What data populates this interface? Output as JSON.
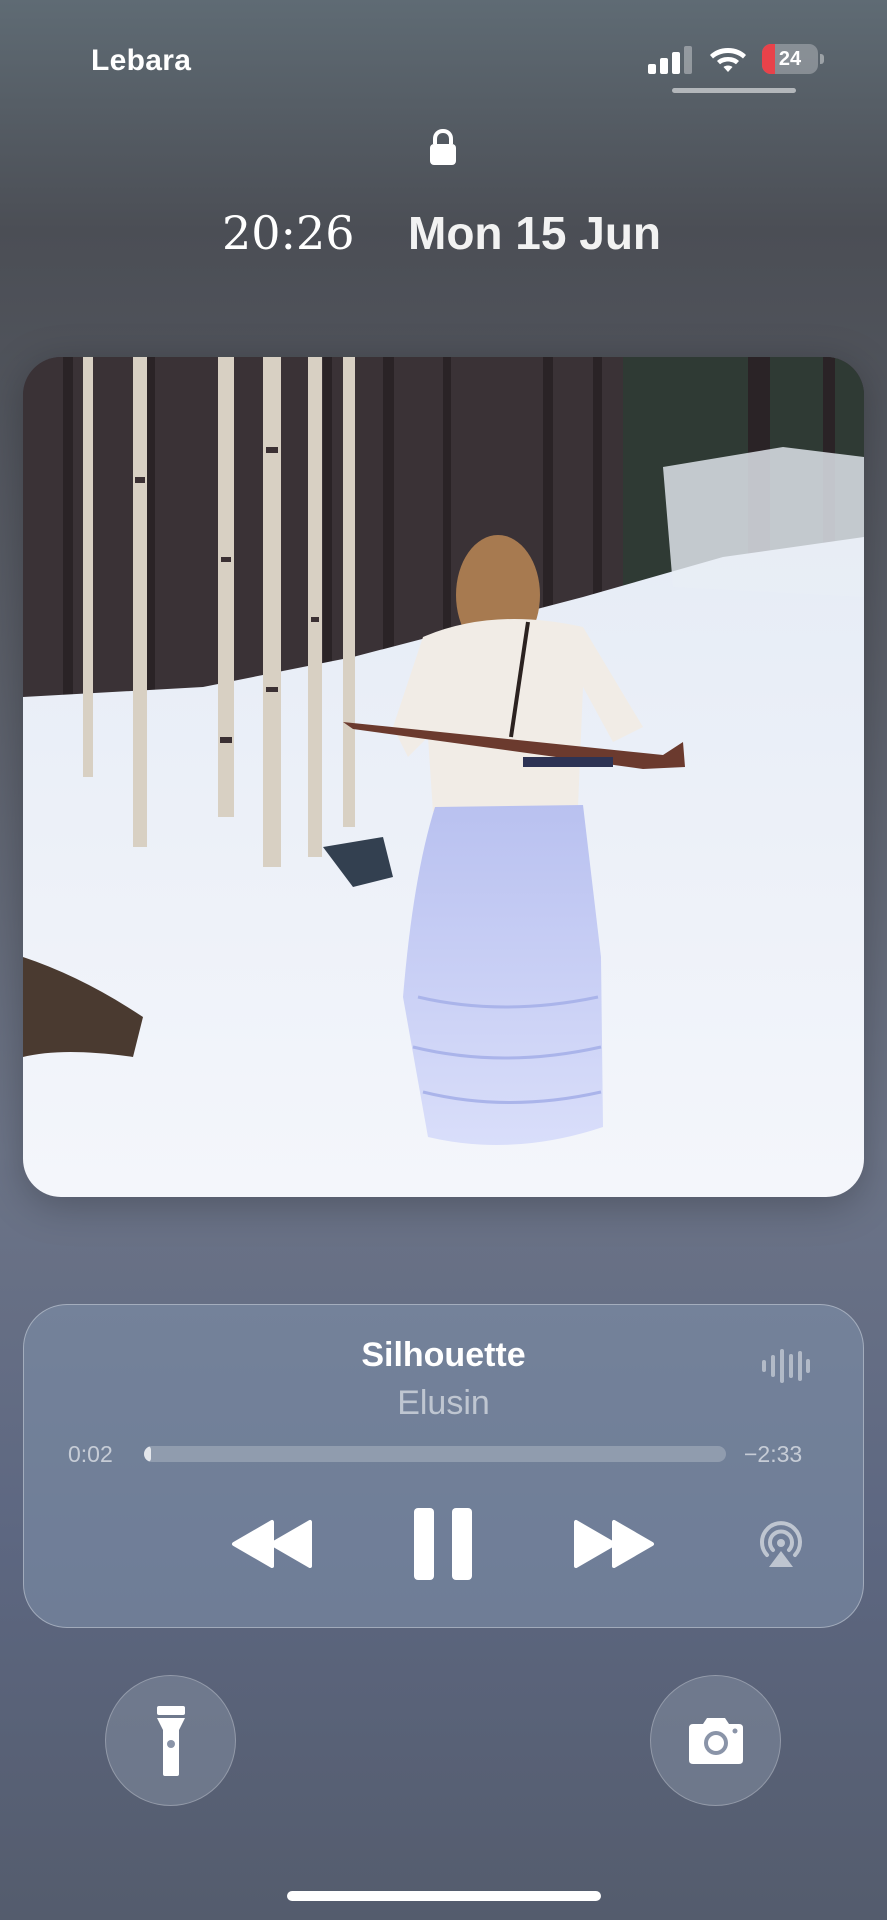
{
  "status_bar": {
    "carrier": "Lebara",
    "signal_bars_active": 3,
    "signal_bars_total": 4,
    "wifi_icon": "wifi-icon",
    "battery_level": "24",
    "battery_fill_fraction": 0.24,
    "battery_color": "#e8424a",
    "battery_charging": true
  },
  "lock_screen": {
    "lock_icon": "lock-icon",
    "time": "20:26",
    "date": "Mon 15 Jun"
  },
  "now_playing": {
    "artwork_description_icon": "album-artwork",
    "title": "Silhouette",
    "artist": "Elusin",
    "elapsed": "0:02",
    "remaining": "−2:33",
    "progress_fraction": 0.012,
    "controls": {
      "rewind_icon": "rewind-icon",
      "pause_icon": "pause-icon",
      "forward_icon": "fast-forward-icon",
      "airplay_icon": "airplay-icon",
      "waveform_icon": "waveform-icon"
    }
  },
  "quick_actions": {
    "flashlight_icon": "flashlight-icon",
    "camera_icon": "camera-icon"
  }
}
